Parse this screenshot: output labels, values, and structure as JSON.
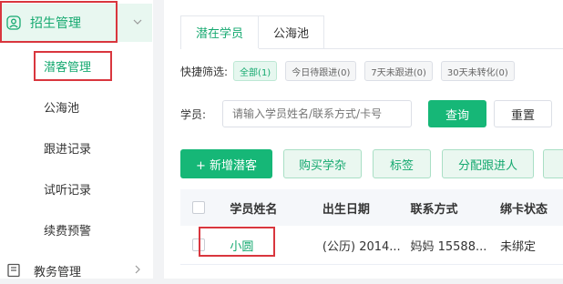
{
  "sidebar": {
    "group": {
      "label": "招生管理",
      "icon": "user-circle-icon",
      "expanded": true
    },
    "items": [
      {
        "label": "潜客管理",
        "active": true
      },
      {
        "label": "公海池",
        "active": false
      },
      {
        "label": "跟进记录",
        "active": false
      },
      {
        "label": "试听记录",
        "active": false
      },
      {
        "label": "续费预警",
        "active": false
      }
    ],
    "bottom": {
      "label": "教务管理",
      "icon": "book-icon"
    }
  },
  "tabs": [
    {
      "label": "潜在学员",
      "active": true
    },
    {
      "label": "公海池",
      "active": false
    }
  ],
  "quick_filter": {
    "label": "快捷筛选:",
    "chips": [
      "全部(1)",
      "今日待跟进(0)",
      "7天未跟进(0)",
      "30天未转化(0)"
    ]
  },
  "student_search": {
    "label": "学员:",
    "placeholder": "请输入学员姓名/联系方式/卡号",
    "query_label": "查询",
    "reset_label": "重置"
  },
  "actions": {
    "add_label": "+ 新增潜客",
    "buy_label": "购买学杂",
    "tag_label": "标签",
    "assign_label": "分配跟进人"
  },
  "table": {
    "columns": [
      "学员姓名",
      "出生日期",
      "联系方式",
      "绑卡状态"
    ],
    "rows": [
      {
        "name": "小圆",
        "birth": "(公历) 2014...",
        "contact": "妈妈 15588...",
        "status": "未绑定"
      }
    ]
  },
  "colors": {
    "accent": "#16b777",
    "highlight": "#d9363e"
  }
}
